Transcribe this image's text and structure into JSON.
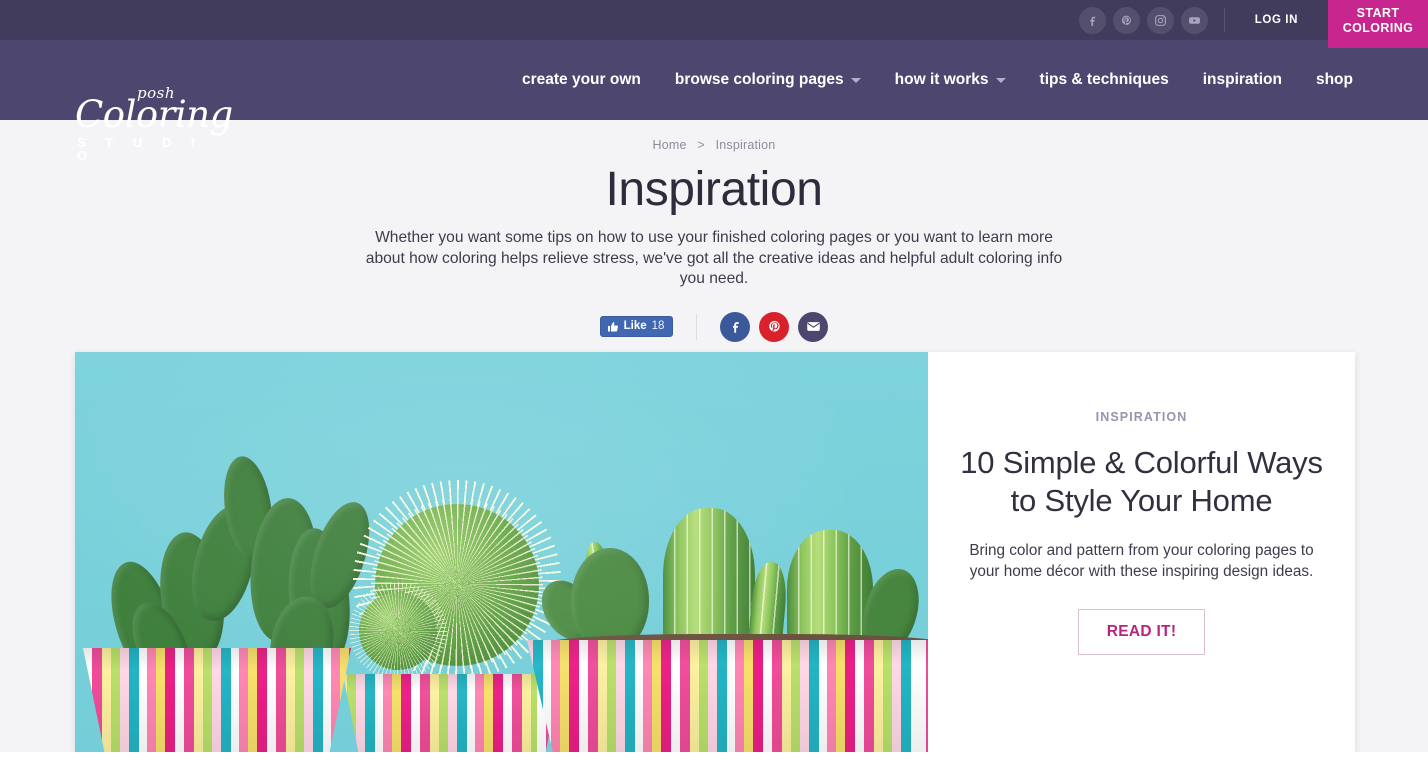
{
  "topbar": {
    "social": [
      {
        "name": "facebook-icon",
        "label": "Facebook"
      },
      {
        "name": "pinterest-icon",
        "label": "Pinterest"
      },
      {
        "name": "instagram-icon",
        "label": "Instagram"
      },
      {
        "name": "youtube-icon",
        "label": "YouTube"
      }
    ],
    "login_label": "LOG IN",
    "start_label_line1": "START",
    "start_label_line2": "COLORING",
    "start_color": "#c6268d",
    "background": "#413c5c"
  },
  "navbar": {
    "background": "#4d4770",
    "logo": {
      "posh": "posh",
      "coloring": "Coloring",
      "studio": "S T U D I O"
    },
    "items": [
      {
        "label": "create your own",
        "caret": false
      },
      {
        "label": "browse coloring pages",
        "caret": true
      },
      {
        "label": "how it works",
        "caret": true
      },
      {
        "label": "tips & techniques",
        "caret": false
      },
      {
        "label": "inspiration",
        "caret": false
      },
      {
        "label": "shop",
        "caret": false
      }
    ]
  },
  "breadcrumb": {
    "home": "Home",
    "separator": ">",
    "current": "Inspiration"
  },
  "page": {
    "title": "Inspiration",
    "description": "Whether you want some tips on how to use your finished coloring pages or you want to learn more about how coloring helps relieve stress, we've got all the creative ideas and helpful adult coloring info you need."
  },
  "share": {
    "like_label": "Like",
    "like_count": "18",
    "buttons": [
      {
        "name": "share-facebook-button",
        "color": "#3b5998"
      },
      {
        "name": "share-pinterest-button",
        "color": "#d9212b"
      },
      {
        "name": "share-email-button",
        "color": "#4d4770"
      }
    ]
  },
  "featured_card": {
    "eyebrow": "INSPIRATION",
    "title": "10 Simple & Colorful Ways to Style Your Home",
    "description": "Bring color and pattern from your coloring pages to your home décor with these inspiring design ideas.",
    "cta_label": "READ IT!",
    "cta_color": "#b8237f",
    "image_alt": "Three cacti in brightly striped pots against a turquoise background"
  }
}
